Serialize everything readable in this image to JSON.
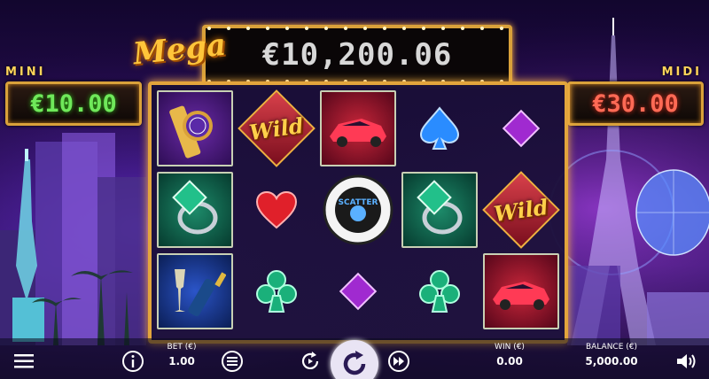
{
  "jackpots": {
    "mini_label": "MINI",
    "mini_value": "€10.00",
    "midi_label": "MIDI",
    "midi_value": "€30.00",
    "mega_label": "Mega",
    "mega_value": "€10,200.06"
  },
  "reels": {
    "wild_text": "Wild",
    "scatter_text": "SCATTER",
    "symbols": [
      [
        "watch",
        "wild",
        "car",
        "spade",
        "diamond"
      ],
      [
        "ring",
        "heart",
        "scatter",
        "ring",
        "wild"
      ],
      [
        "champagne",
        "club",
        "diamond",
        "club",
        "car"
      ]
    ]
  },
  "bottom_bar": {
    "bet_label": "BET (€)",
    "bet_value": "1.00",
    "win_label": "WIN (€)",
    "win_value": "0.00",
    "balance_label": "BALANCE (€)",
    "balance_value": "5,000.00",
    "icons": [
      "menu-icon",
      "info-icon",
      "coins-icon",
      "autoplay-icon",
      "spin-icon",
      "fast-forward-icon",
      "sound-icon"
    ]
  },
  "colors": {
    "gold_frame": "#e3a53c",
    "mini_green": "#6fe85a",
    "midi_red": "#ff6a55",
    "background": "#2a0d56"
  }
}
